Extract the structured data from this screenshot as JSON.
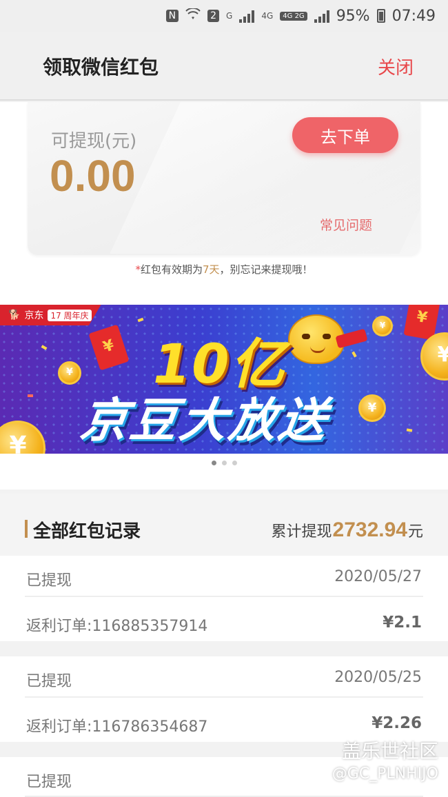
{
  "status_bar": {
    "nfc": "N",
    "sim_badge": "2",
    "net_g": "G",
    "net_4g": "4G",
    "net_4g2g": "4G 2G",
    "battery": "95%",
    "time": "07:49"
  },
  "header": {
    "title": "领取微信红包",
    "close_label": "关闭"
  },
  "balance": {
    "label": "可提现(元)",
    "amount": "0.00",
    "order_button": "去下单",
    "faq_link": "常见问题"
  },
  "notice": {
    "star": "*",
    "prefix": "红包有效期为",
    "days": "7天",
    "suffix": "，别忘记来提现哦！"
  },
  "banner": {
    "brand": "京东",
    "anniversary": "17 周年庆",
    "headline_1": "10亿",
    "headline_2": "京豆大放送",
    "slides": 3,
    "active_slide": 1
  },
  "records": {
    "title": "全部红包记录",
    "total_prefix": "累计提现",
    "total_value": "2732.94",
    "total_unit": "元",
    "items": [
      {
        "status": "已提现",
        "date": "2020/05/27",
        "order": "返利订单:116885357914",
        "amount": "¥2.1"
      },
      {
        "status": "已提现",
        "date": "2020/05/25",
        "order": "返利订单:116786354687",
        "amount": "¥2.26"
      },
      {
        "status": "已提现",
        "date": "",
        "order": "",
        "amount": ""
      }
    ]
  },
  "watermark": {
    "line1": "盖乐世社区",
    "line2": "@GC_PLNHIJO"
  }
}
